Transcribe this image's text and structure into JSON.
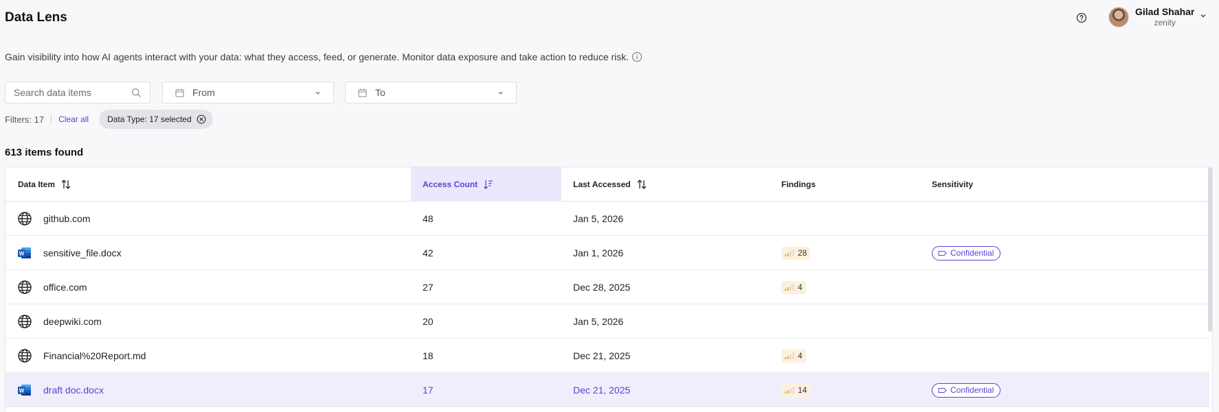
{
  "header": {
    "title": "Data Lens",
    "user": {
      "name": "Gilad Shahar",
      "org": "zenity"
    }
  },
  "description": "Gain visibility into how AI agents interact with your data: what they access, feed, or generate. Monitor data exposure and take action to reduce risk.",
  "search": {
    "placeholder": "Search data items",
    "value": ""
  },
  "date_from": {
    "label": "From"
  },
  "date_to": {
    "label": "To"
  },
  "filters": {
    "count_label": "Filters: 17",
    "clear_label": "Clear all",
    "chip_label": "Data Type: 17 selected"
  },
  "results": {
    "count_label": "613 items found"
  },
  "table": {
    "columns": {
      "data_item": "Data Item",
      "access_count": "Access Count",
      "last_accessed": "Last Accessed",
      "findings": "Findings",
      "sensitivity": "Sensitivity"
    },
    "rows": [
      {
        "icon": "globe-icon",
        "name": "github.com",
        "access_count": "48",
        "last_accessed": "Jan 5, 2026",
        "findings": "",
        "sensitivity": ""
      },
      {
        "icon": "word-doc-icon",
        "name": "sensitive_file.docx",
        "access_count": "42",
        "last_accessed": "Jan 1, 2026",
        "findings": "28",
        "sensitivity": "Confidential"
      },
      {
        "icon": "globe-icon",
        "name": "office.com",
        "access_count": "27",
        "last_accessed": "Dec 28, 2025",
        "findings": "4",
        "sensitivity": ""
      },
      {
        "icon": "globe-icon",
        "name": "deepwiki.com",
        "access_count": "20",
        "last_accessed": "Jan 5, 2026",
        "findings": "",
        "sensitivity": ""
      },
      {
        "icon": "globe-icon",
        "name": "Financial%20Report.md",
        "access_count": "18",
        "last_accessed": "Dec 21, 2025",
        "findings": "4",
        "sensitivity": ""
      },
      {
        "icon": "word-doc-icon",
        "name": "draft doc.docx",
        "access_count": "17",
        "last_accessed": "Dec 21, 2025",
        "findings": "14",
        "sensitivity": "Confidential",
        "highlighted": true
      }
    ]
  },
  "colors": {
    "accent": "#5b3fd6",
    "accent_bg": "#ece8fb",
    "findings_bg": "#fdf1dd",
    "findings_bar": "#e8b764",
    "word_blue": "#185abd"
  }
}
